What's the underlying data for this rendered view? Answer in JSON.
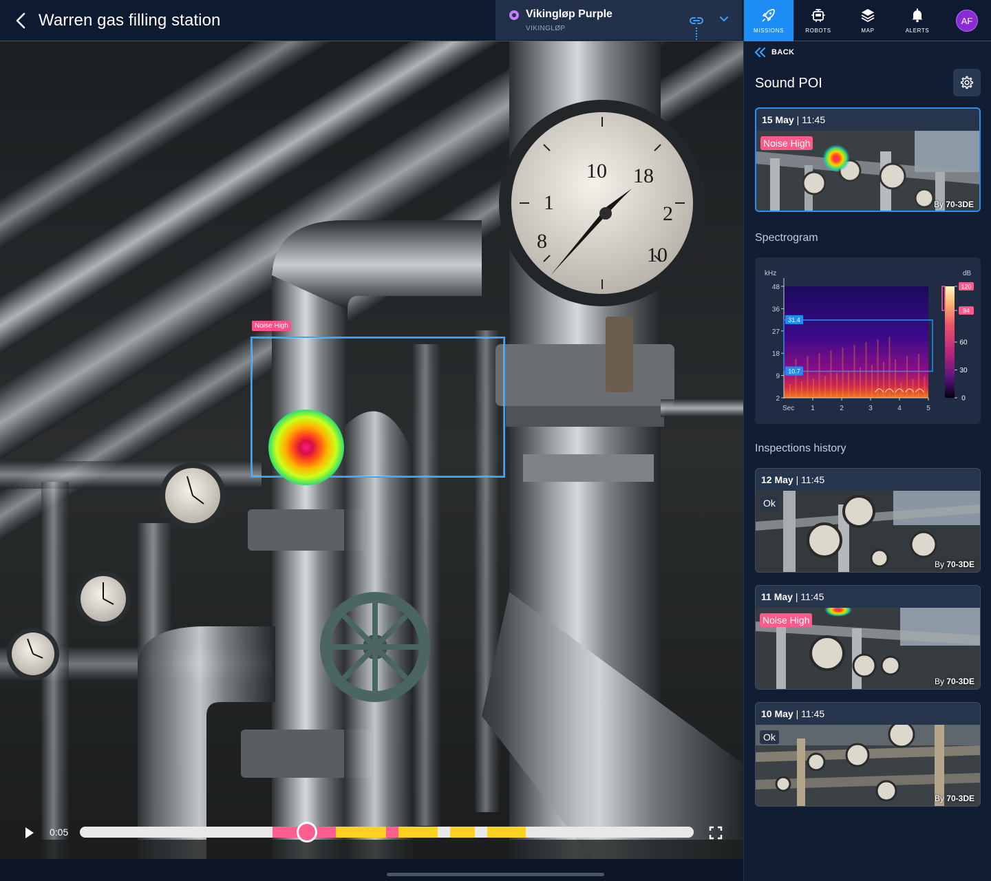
{
  "header": {
    "title": "Warren gas filling station",
    "mission": {
      "name": "Vikingløp Purple",
      "subtitle": "VIKINGLØP",
      "dot_color": "#c77bff"
    }
  },
  "nav": {
    "items": [
      {
        "label": "MISSIONS",
        "icon": "rocket-icon",
        "active": true
      },
      {
        "label": "ROBOTS",
        "icon": "robot-icon",
        "active": false
      },
      {
        "label": "MAP",
        "icon": "layers-icon",
        "active": false
      },
      {
        "label": "ALERTS",
        "icon": "bell-icon",
        "active": false
      }
    ],
    "avatar": "AF"
  },
  "viewer": {
    "poi_label": "Noise High",
    "time": "0:05",
    "progress_fraction": 0.37,
    "timeline_segments": [
      {
        "start": 0.0,
        "end": 0.314,
        "color": "#e8e8e8"
      },
      {
        "start": 0.314,
        "end": 0.417,
        "color": "#ff5f8f"
      },
      {
        "start": 0.417,
        "end": 0.499,
        "color": "#ffd21f"
      },
      {
        "start": 0.499,
        "end": 0.519,
        "color": "#ff5f8f"
      },
      {
        "start": 0.519,
        "end": 0.583,
        "color": "#ffd21f"
      },
      {
        "start": 0.583,
        "end": 0.603,
        "color": "#e8e8e8"
      },
      {
        "start": 0.603,
        "end": 0.643,
        "color": "#ffd21f"
      },
      {
        "start": 0.643,
        "end": 0.664,
        "color": "#e8e8e8"
      },
      {
        "start": 0.664,
        "end": 0.727,
        "color": "#ffd21f"
      },
      {
        "start": 0.727,
        "end": 1.0,
        "color": "#e8e8e8"
      }
    ]
  },
  "panel": {
    "back_label": "BACK",
    "title": "Sound POI",
    "current": {
      "date": "15 May",
      "time": "11:45",
      "status": "Noise High",
      "by_prefix": "By",
      "robot": "70-3DE"
    },
    "spectrogram_label": "Spectrogram",
    "history_label": "Inspections history",
    "history": [
      {
        "date": "12 May",
        "time": "11:45",
        "status": "Ok",
        "by_prefix": "By",
        "robot": "70-3DE"
      },
      {
        "date": "11 May",
        "time": "11:45",
        "status": "Noise High",
        "by_prefix": "By",
        "robot": "70-3DE"
      },
      {
        "date": "10 May",
        "time": "11:45",
        "status": "Ok",
        "by_prefix": "By",
        "robot": "70-3DE"
      }
    ]
  },
  "chart_data": {
    "type": "heatmap",
    "xlabel": "Sec",
    "ylabel": "kHz",
    "colorbar_label": "dB",
    "x_ticks": [
      1,
      2,
      3,
      4,
      5
    ],
    "y_ticks": [
      2,
      9,
      18,
      27,
      36,
      48
    ],
    "colorbar_ticks": [
      0,
      30,
      60,
      94,
      120
    ],
    "selection_band_khz": [
      10.7,
      31.4
    ],
    "band_labels": [
      "31.4",
      "10.7"
    ],
    "db_range_marker": [
      94,
      120
    ]
  },
  "colors": {
    "accent": "#1e8cf5",
    "alert": "#ff5a8a",
    "background": "#111d33"
  }
}
